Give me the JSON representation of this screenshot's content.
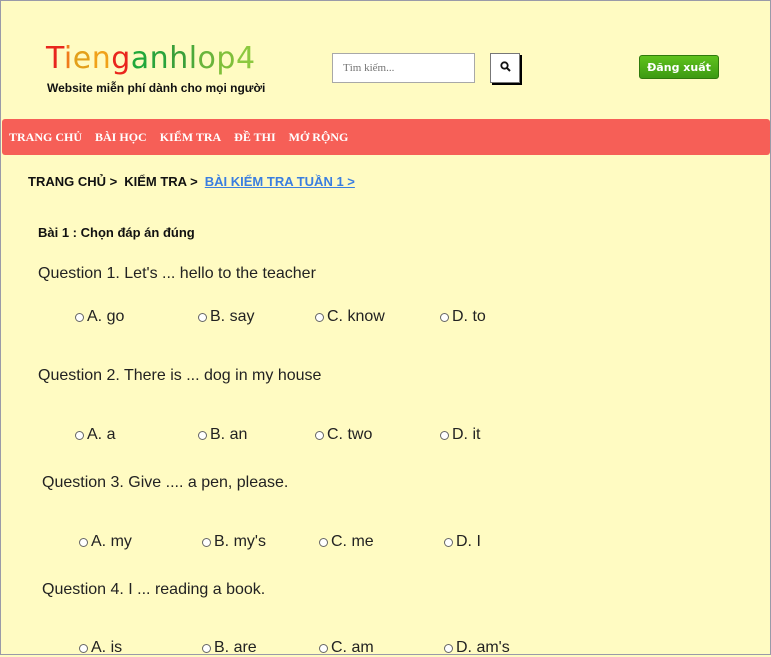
{
  "header": {
    "logo_letters": [
      {
        "ch": "T",
        "color": "#e8261d"
      },
      {
        "ch": "i",
        "color": "#f07b1c"
      },
      {
        "ch": "e",
        "color": "#e3a01a"
      },
      {
        "ch": "n",
        "color": "#f0a21a"
      },
      {
        "ch": "g",
        "color": "#e9261d"
      },
      {
        "ch": "a",
        "color": "#22a83a"
      },
      {
        "ch": "n",
        "color": "#2aa43c"
      },
      {
        "ch": "h",
        "color": "#3a9f3a"
      },
      {
        "ch": "l",
        "color": "#4ca93a"
      },
      {
        "ch": "o",
        "color": "#6ab43c"
      },
      {
        "ch": "p",
        "color": "#7fbf3a"
      },
      {
        "ch": "4",
        "color": "#8cc83f"
      }
    ],
    "tagline": "Website miễn phí dành cho mọi người",
    "search_placeholder": "Tìm kiếm...",
    "search_icon": "search-icon",
    "logout_label": "Đăng xuất"
  },
  "nav": {
    "items": [
      "TRANG CHỦ",
      "BÀI HỌC",
      "KIỂM TRA",
      "ĐỀ THI",
      "MỞ RỘNG"
    ]
  },
  "breadcrumb": {
    "items": [
      "TRANG CHỦ >",
      "KIỂM TRA >",
      "BÀI KIỂM TRA TUẦN 1 >"
    ]
  },
  "exercise": {
    "title": "Bài 1 : Chọn đáp án đúng",
    "questions": [
      {
        "text": "Question 1. Let's ... hello to the teacher",
        "options": [
          "A. go",
          "B. say",
          "C. know",
          "D. to"
        ]
      },
      {
        "text": "Question 2. There is ... dog in my house",
        "options": [
          "A. a",
          "B. an",
          "C. two",
          "D. it"
        ]
      },
      {
        "text": "Question 3. Give .... a pen, please.",
        "options": [
          "A. my",
          "B. my's",
          "C. me",
          "D. I"
        ]
      },
      {
        "text": "Question 4. I ... reading a book.",
        "options": [
          "A. is",
          "B. are",
          "C. am",
          "D. am's"
        ]
      }
    ]
  }
}
